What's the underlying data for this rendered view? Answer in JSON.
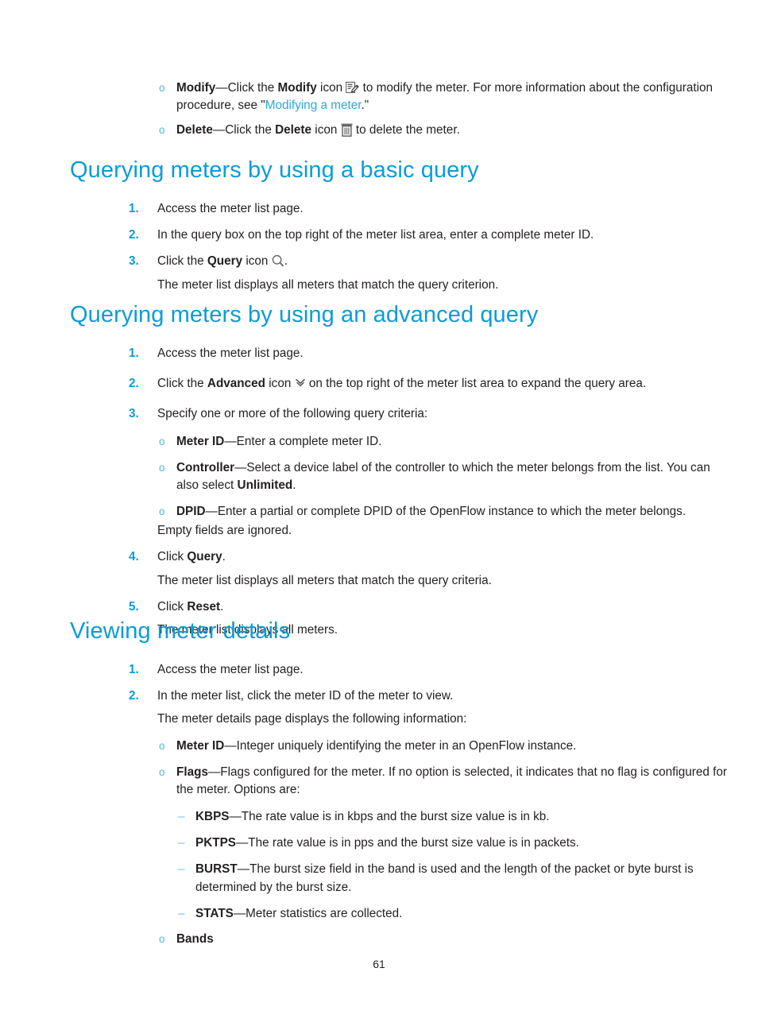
{
  "page": {
    "number": "61",
    "accent_color": "#0b9cd8",
    "bullet_color": "#49b9e8",
    "dash_color": "#6ec6ea",
    "link_color": "#27a9e1",
    "text_color": "#231f20"
  },
  "top_bullets": [
    {
      "marker": "o",
      "bold_lead": "Modify",
      "text_1": "—Click the ",
      "bold_mid": "Modify",
      "text_2": " icon ",
      "icon": "modify-pencil-icon",
      "text_3": " to modify the meter. For more information about the configuration procedure, see \"",
      "link": "Modifying a meter",
      "text_4": ".\""
    },
    {
      "marker": "o",
      "bold_lead": "Delete",
      "text_1": "—Click the ",
      "bold_mid": "Delete",
      "text_2": " icon ",
      "icon": "delete-trash-icon",
      "text_3": " to delete the meter."
    }
  ],
  "section_basic_query": {
    "heading": "Querying meters by using a basic query",
    "steps": [
      {
        "marker": "1.",
        "text": "Access the meter list page."
      },
      {
        "marker": "2.",
        "text": "In the query box on the top right of the meter list area, enter a complete meter ID."
      },
      {
        "marker": "3.",
        "text_1": "Click the ",
        "bold": "Query",
        "text_2": " icon ",
        "icon": "query-magnifier-icon",
        "text_3": "."
      }
    ],
    "result_text": "The meter list displays all meters that match the query criterion."
  },
  "section_advanced_query": {
    "heading": "Querying meters by using an advanced query",
    "steps": [
      {
        "marker": "1.",
        "text": "Access the meter list page."
      },
      {
        "marker": "2.",
        "text_1": "Click the ",
        "bold": "Advanced",
        "text_2": " icon ",
        "icon": "advanced-double-chevron-down-icon",
        "text_3": " on the top right of the meter list area to expand the query area."
      },
      {
        "marker": "3.",
        "text": "Specify one or more of the following query criteria:"
      }
    ],
    "criteria": [
      {
        "marker": "o",
        "bold": "Meter ID",
        "text": "—Enter a complete meter ID."
      },
      {
        "marker": "o",
        "bold": "Controller",
        "text_1": "—Select a device label of the controller to which the meter belongs from the list. You can also select ",
        "bold_2": "Unlimited",
        "text_2": "."
      },
      {
        "marker": "o",
        "bold": "DPID",
        "text": "—Enter a partial or complete DPID of the OpenFlow instance to which the meter belongs."
      }
    ],
    "empty_fields_note": "Empty fields are ignored.",
    "steps_cont": [
      {
        "marker": "4.",
        "text_1": "Click ",
        "bold": "Query",
        "text_2": ".",
        "result": "The meter list displays all meters that match the query criteria."
      },
      {
        "marker": "5.",
        "text_1": "Click ",
        "bold": "Reset",
        "text_2": ".",
        "result": "The meter list displays all meters."
      }
    ]
  },
  "section_view_details": {
    "heading": "Viewing meter details",
    "steps": [
      {
        "marker": "1.",
        "text": "Access the meter list page."
      },
      {
        "marker": "2.",
        "text": "In the meter list, click the meter ID of the meter to view."
      }
    ],
    "intro_text": "The meter details page displays the following information:",
    "fields": [
      {
        "marker": "o",
        "bold": "Meter ID",
        "text": "—Integer uniquely identifying the meter in an OpenFlow instance."
      },
      {
        "marker": "o",
        "bold": "Flags",
        "text": "—Flags configured for the meter. If no option is selected, it indicates that no flag is configured for the meter. Options are:"
      }
    ],
    "flag_options": [
      {
        "marker": "–",
        "bold": "KBPS",
        "text": "—The rate value is in kbps and the burst size value is in kb."
      },
      {
        "marker": "–",
        "bold": "PKTPS",
        "text": "—The rate value is in pps and the burst size value is in packets."
      },
      {
        "marker": "–",
        "bold": "BURST",
        "text": "—The burst size field in the band is used and the length of the packet or byte burst is determined by the burst size."
      },
      {
        "marker": "–",
        "bold": "STATS",
        "text": "—Meter statistics are collected."
      }
    ],
    "bands_item": {
      "marker": "o",
      "bold": "Bands"
    }
  }
}
